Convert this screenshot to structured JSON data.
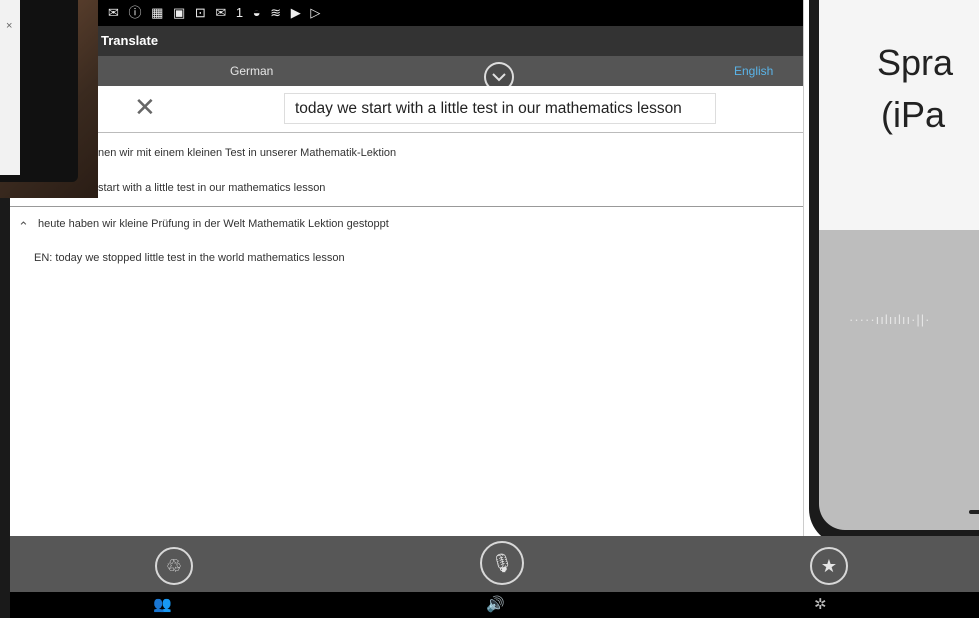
{
  "app": {
    "title": "Translate"
  },
  "status_bar": {
    "icons": "✉ ⓘ ▦ ▣ ⊡ ✉ 1 ◒ ≋ ▶ ▷"
  },
  "languages": {
    "source": "German",
    "target": "English"
  },
  "input": {
    "value": "today we start with a little test in our mathematics lesson"
  },
  "translations": [
    {
      "text": "nen wir mit einem kleinen Test in unserer Mathematik-Lektion"
    },
    {
      "text": "start with a little test in our mathematics lesson"
    },
    {
      "text": "heute haben wir kleine Prüfung in der Welt Mathematik Lektion gestoppt"
    },
    {
      "text": "EN:  today we stopped little test in the world mathematics lesson"
    }
  ],
  "overlay": {
    "line1": "Spra",
    "line2": "(iPa"
  },
  "actions": {
    "recycle": "♲",
    "mic": "🎙",
    "star": "★"
  },
  "nav": {
    "conversation": "👥",
    "speech": "🔊",
    "other": "✲"
  },
  "icons": {
    "clear": "close-icon",
    "toggle": "chevron-down-icon",
    "recycle": "recycle-icon",
    "mic": "microphone-icon",
    "star": "star-icon"
  },
  "colors": {
    "accent": "#5ab4e8",
    "status_bar": "#000000",
    "lang_bar": "#555555",
    "action_bar": "#575757"
  }
}
